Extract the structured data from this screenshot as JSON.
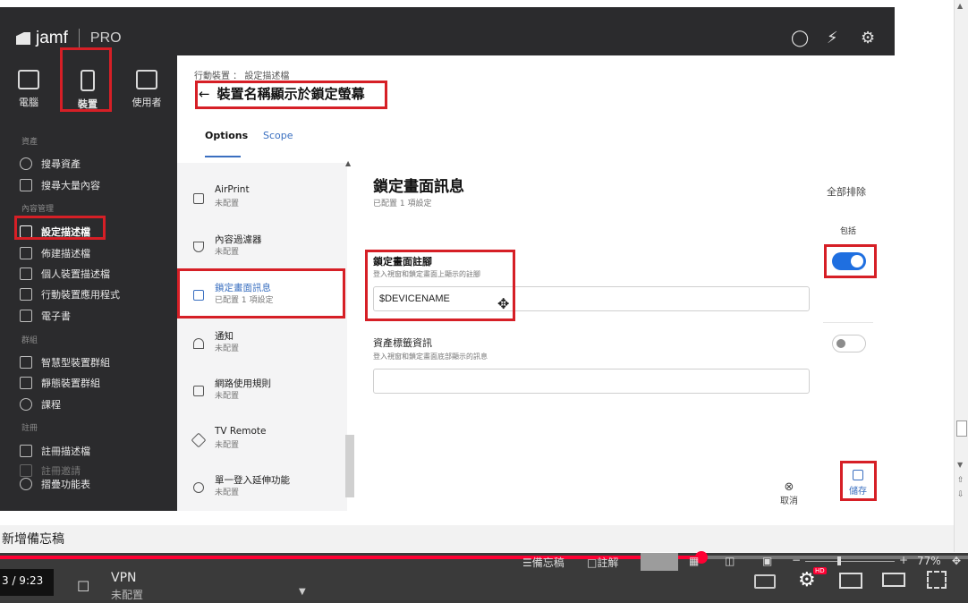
{
  "app": {
    "logo_text": "jamf",
    "logo_suffix": "PRO"
  },
  "topnav": [
    {
      "label": "電腦"
    },
    {
      "label": "裝置"
    },
    {
      "label": "使用者"
    }
  ],
  "sidebar": {
    "sec_assets": "資產",
    "search_inventory": "搜尋資產",
    "search_volume": "搜尋大量內容",
    "sec_content": "內容管理",
    "config_profiles": "設定描述檔",
    "provisioning": "佈建描述檔",
    "personal_profiles": "個人裝置描述檔",
    "mobile_apps": "行動裝置應用程式",
    "ebooks": "電子書",
    "sec_groups": "群組",
    "smart_groups": "智慧型裝置群組",
    "static_groups": "靜態裝置群組",
    "classes": "課程",
    "sec_enroll": "註冊",
    "enroll_profiles": "註冊描述檔",
    "enroll_invites": "註冊邀請",
    "collapse": "摺疊功能表"
  },
  "panel": {
    "breadcrumb": "行動裝置 ： 設定描述檔",
    "title": "裝置名稱顯示於鎖定螢幕",
    "tab_options": "Options",
    "tab_scope": "Scope"
  },
  "payloads": [
    {
      "title": "AirPrint",
      "sub": "未配置"
    },
    {
      "title": "內容過濾器",
      "sub": "未配置"
    },
    {
      "title": "鎖定畫面訊息",
      "sub": "已配置 1 項設定"
    },
    {
      "title": "通知",
      "sub": "未配置"
    },
    {
      "title": "網路使用規則",
      "sub": "未配置"
    },
    {
      "title": "TV Remote",
      "sub": "未配置"
    },
    {
      "title": "單一登入延伸功能",
      "sub": "未配置"
    }
  ],
  "detail": {
    "heading": "鎖定畫面訊息",
    "subheading": "已配置 1 項設定",
    "exclude_all": "全部排除",
    "include": "包括",
    "footnote_label": "鎖定畫面註腳",
    "footnote_desc": "登入視窗和鎖定畫面上顯示的註腳",
    "footnote_value": "$DEVICENAME",
    "asset_label": "資產標籤資訊",
    "asset_desc": "登入視窗和鎖定畫面底部顯示的訊息",
    "asset_value": "",
    "cancel": "取消",
    "save": "儲存"
  },
  "youtube": {
    "memo": "新增備忘稿",
    "time": "3 / 9:23",
    "vpn_title": "VPN",
    "vpn_sub": "未配置",
    "notes": "備忘稿",
    "comments": "註解",
    "zoom": "77%",
    "zoom_minus": "−",
    "zoom_plus": "+",
    "hd": "HD",
    "progress_fraction": 0.725
  }
}
